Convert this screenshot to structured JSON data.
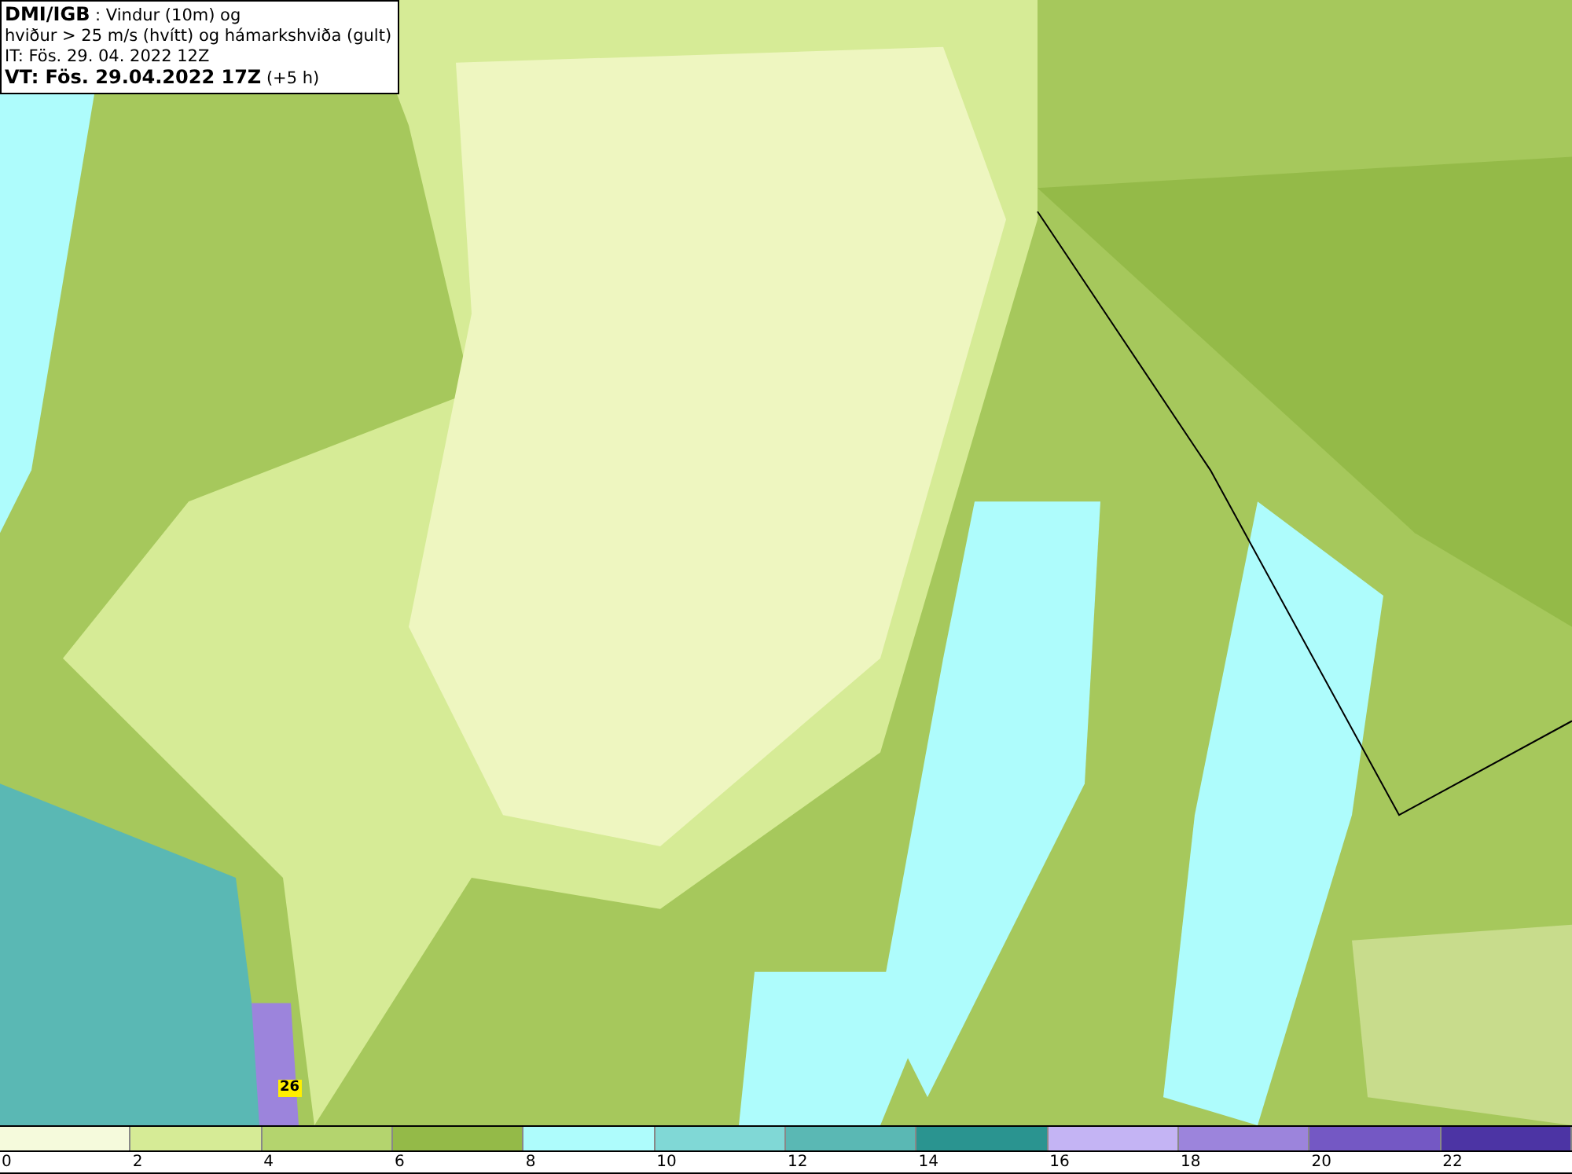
{
  "title_box": {
    "lines": [
      "**DMI/IGB** : Vindur (10m) og",
      "hviður > 25 m/s (hvítt) og hámarkshviða (gult)",
      "IT: Fös. 29. 04. 2022 12Z",
      "**VT: Fös. 29.04.2022 17Z** (+5 h)"
    ]
  },
  "map": {
    "gust_label": "26"
  },
  "legend": [
    {
      "label": "0",
      "color": "#f5fadc"
    },
    {
      "label": "2",
      "color": "#d6eb96"
    },
    {
      "label": "4",
      "color": "#b4d46e"
    },
    {
      "label": "6",
      "color": "#94ba48"
    },
    {
      "label": "8",
      "color": "#aefcfc"
    },
    {
      "label": "10",
      "color": "#80d8d6"
    },
    {
      "label": "12",
      "color": "#5ab8b4"
    },
    {
      "label": "14",
      "color": "#2a9490"
    },
    {
      "label": "16",
      "color": "#c4b4f4"
    },
    {
      "label": "18",
      "color": "#9c84dc"
    },
    {
      "label": "20",
      "color": "#7458c4"
    },
    {
      "label": "22",
      "color": "#4c34a4"
    }
  ]
}
